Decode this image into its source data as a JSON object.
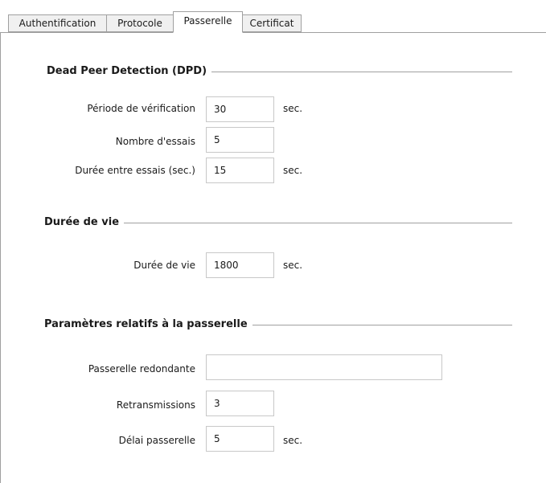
{
  "tabs": [
    {
      "label": "Authentification"
    },
    {
      "label": "Protocole"
    },
    {
      "label": "Passerelle",
      "active": true
    },
    {
      "label": "Certificat"
    }
  ],
  "dpd": {
    "title": "Dead Peer Detection (DPD)",
    "periode_label": "Période de vérification",
    "periode_value": "30",
    "periode_unit": "sec.",
    "essais_label": "Nombre d'essais",
    "essais_value": "5",
    "duree_entre_label": "Durée entre essais (sec.)",
    "duree_entre_value": "15",
    "duree_entre_unit": "sec."
  },
  "vie": {
    "title": "Durée de vie",
    "label": "Durée de vie",
    "value": "1800",
    "unit": "sec."
  },
  "passerelle": {
    "title": "Paramètres relatifs à la passerelle",
    "redondante_label": "Passerelle redondante",
    "redondante_value": "",
    "retrans_label": "Retransmissions",
    "retrans_value": "3",
    "delai_label": "Délai passerelle",
    "delai_value": "5",
    "delai_unit": "sec."
  }
}
